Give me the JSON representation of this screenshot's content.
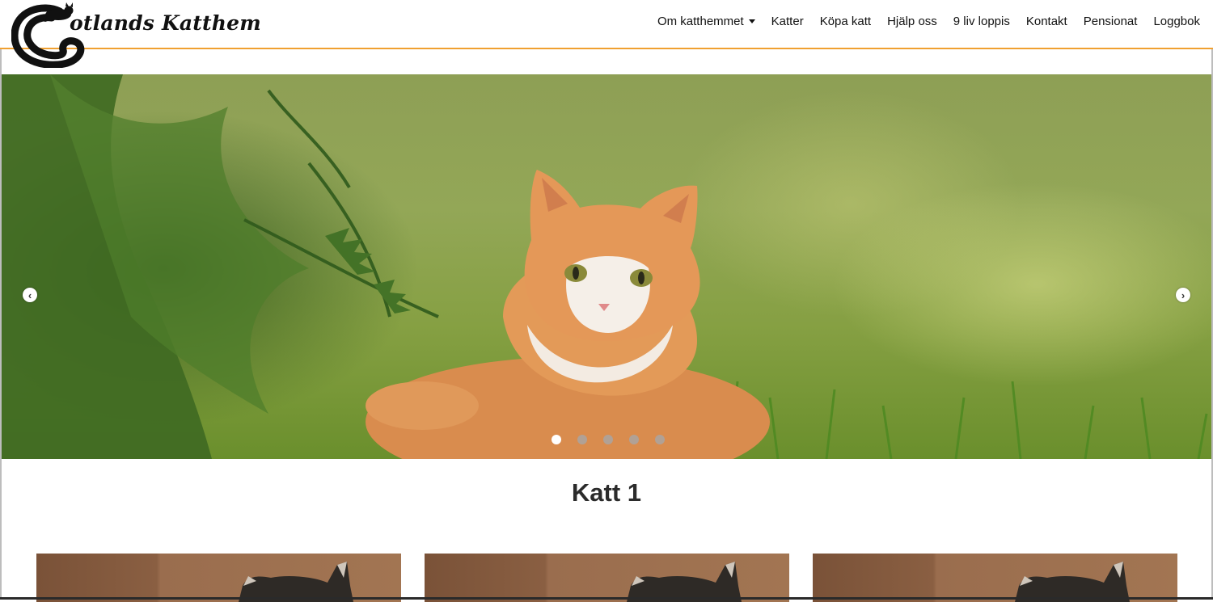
{
  "brand": {
    "name": "Gotlands Katthem",
    "logo_text": "otlands Katthem"
  },
  "nav": {
    "items": [
      {
        "label": "Om katthemmet",
        "dropdown": true
      },
      {
        "label": "Katter"
      },
      {
        "label": "Köpa katt"
      },
      {
        "label": "Hjälp oss"
      },
      {
        "label": "9 liv loppis"
      },
      {
        "label": "Kontakt"
      },
      {
        "label": "Pensionat"
      },
      {
        "label": "Loggbok"
      }
    ]
  },
  "hero": {
    "prev_icon": "chevron-left-icon",
    "next_icon": "chevron-right-icon",
    "slide_count": 5,
    "active_slide": 1
  },
  "section": {
    "title": "Katt 1"
  },
  "colors": {
    "accent": "#f0a030",
    "text": "#111111"
  }
}
